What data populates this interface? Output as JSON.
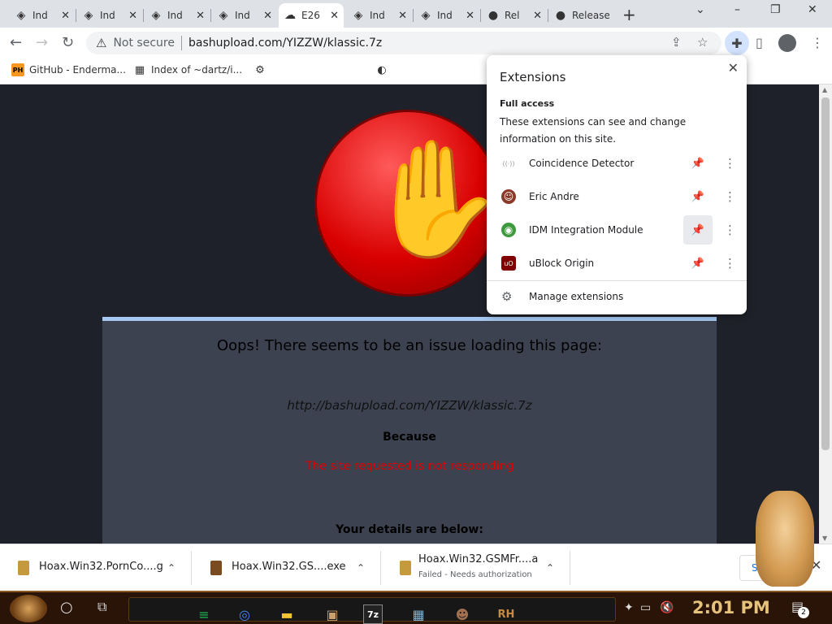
{
  "browser": {
    "tabs": [
      {
        "title": "Ind",
        "icon": "bash-icon",
        "active": false
      },
      {
        "title": "Ind",
        "icon": "bash-icon",
        "active": false
      },
      {
        "title": "Ind",
        "icon": "bash-icon",
        "active": false
      },
      {
        "title": "Ind",
        "icon": "bash-icon",
        "active": false
      },
      {
        "title": "E26",
        "icon": "cloud-upload-icon",
        "active": true
      },
      {
        "title": "Ind",
        "icon": "bash-icon",
        "active": false
      },
      {
        "title": "Ind",
        "icon": "bash-icon",
        "active": false
      },
      {
        "title": "Rel",
        "icon": "github-icon",
        "active": false
      },
      {
        "title": "Release",
        "icon": "github-icon",
        "active": false
      }
    ],
    "new_tab": "+",
    "window_controls": {
      "dropdown": "⌄",
      "minimize": "–",
      "restore": "❐",
      "close": "✕"
    },
    "omnibox": {
      "security_label": "Not secure",
      "url": "bashupload.com/YIZZW/klassic.7z"
    },
    "bookmarks": [
      {
        "label": "GitHub - Enderma...",
        "icon": "PH"
      },
      {
        "label": "Index of ~dartz/i...",
        "icon": "▦"
      },
      {
        "label": "",
        "icon": "⚙"
      },
      {
        "label": "",
        "icon": "◐"
      }
    ]
  },
  "page": {
    "headline": "Oops! There seems to be an issue loading this page:",
    "url": "http://bashupload.com/YIZZW/klassic.7z",
    "because": "Because",
    "reason": "The site requested is not responding",
    "details": "Your details are below:"
  },
  "extensions_popup": {
    "title": "Extensions",
    "close": "✕",
    "section": "Full access",
    "description": "These extensions can see and change information on this site.",
    "items": [
      {
        "name": "Coincidence Detector",
        "icon": "((·))"
      },
      {
        "name": "Eric Andre",
        "icon": "☺"
      },
      {
        "name": "IDM Integration Module",
        "icon": "◉"
      },
      {
        "name": "uBlock Origin",
        "icon": "uO"
      }
    ],
    "manage": "Manage extensions"
  },
  "downloads": [
    {
      "name": "Hoax.Win32.PornCo....g",
      "status": ""
    },
    {
      "name": "Hoax.Win32.GS....exe",
      "status": ""
    },
    {
      "name": "Hoax.Win32.GSMFr....a",
      "status": "Failed - Needs authorization"
    }
  ],
  "downloads_show_all": "Show all",
  "taskbar": {
    "time": "2:01 PM",
    "notifications": "2",
    "apps": [
      "≡",
      "◎",
      "▬",
      "▣",
      "7z",
      "▦",
      "☻",
      "RH"
    ],
    "app_colors": [
      "#1db954",
      "#4285f4",
      "#f4c430",
      "#c8a070",
      "#ffffff",
      "#7fb3d5",
      "#a07050",
      "#c88a40"
    ]
  }
}
